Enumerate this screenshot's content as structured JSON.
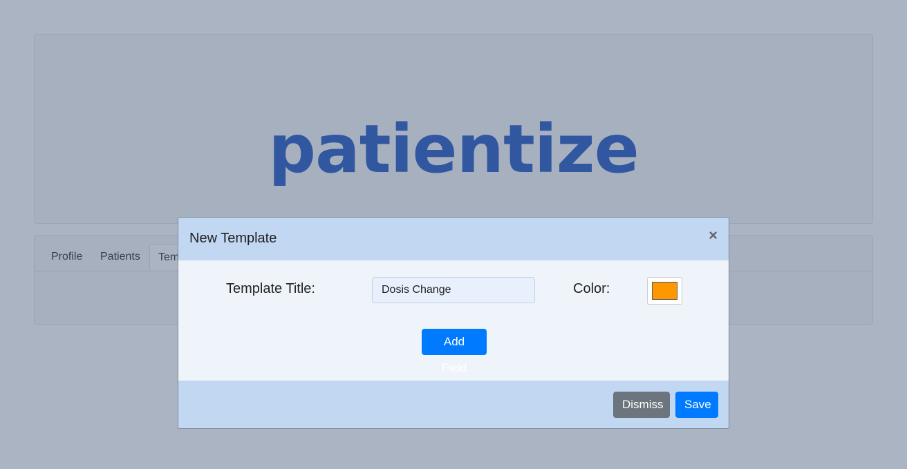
{
  "app": {
    "logo_text": "patientize",
    "logo_color": "#2f5fc4"
  },
  "tabs": [
    {
      "label": "Profile"
    },
    {
      "label": "Patients"
    },
    {
      "label": "Templates"
    }
  ],
  "modal": {
    "title": "New Template",
    "close_glyph": "×",
    "template_title_label": "Template Title:",
    "template_title_value": "Dosis Change",
    "color_label": "Color:",
    "color_value": "#ff9800",
    "add_field_label": "Add Field",
    "dismiss_label": "Dismiss",
    "save_label": "Save"
  },
  "colors": {
    "primary": "#007bff",
    "secondary": "#6c757d",
    "modal_header": "#c1d7f2"
  }
}
